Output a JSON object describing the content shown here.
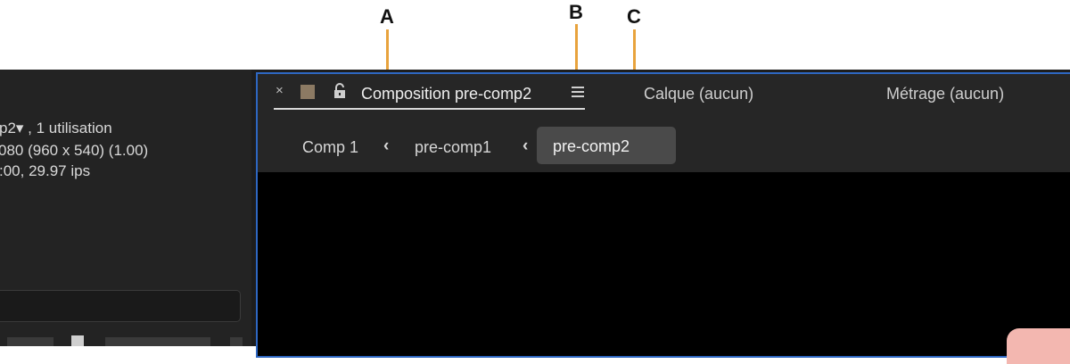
{
  "callouts": [
    "A",
    "B",
    "C"
  ],
  "left_panel": {
    "line1": "p2▾ , 1 utilisation",
    "line2": "080  (960 x 540) (1.00)",
    "line3": ":00, 29.97 ips"
  },
  "composition_panel": {
    "active_tab": "Composition pre-comp2",
    "other_tabs": [
      "Calque (aucun)",
      "Métrage (aucun)"
    ],
    "close_symbol": "×"
  },
  "breadcrumbs": [
    "Comp 1",
    "pre-comp1",
    "pre-comp2"
  ],
  "colors": {
    "accent_border": "#2e67c2",
    "leader_line": "#e8a33d",
    "label_swatch": "#8c7a63"
  }
}
